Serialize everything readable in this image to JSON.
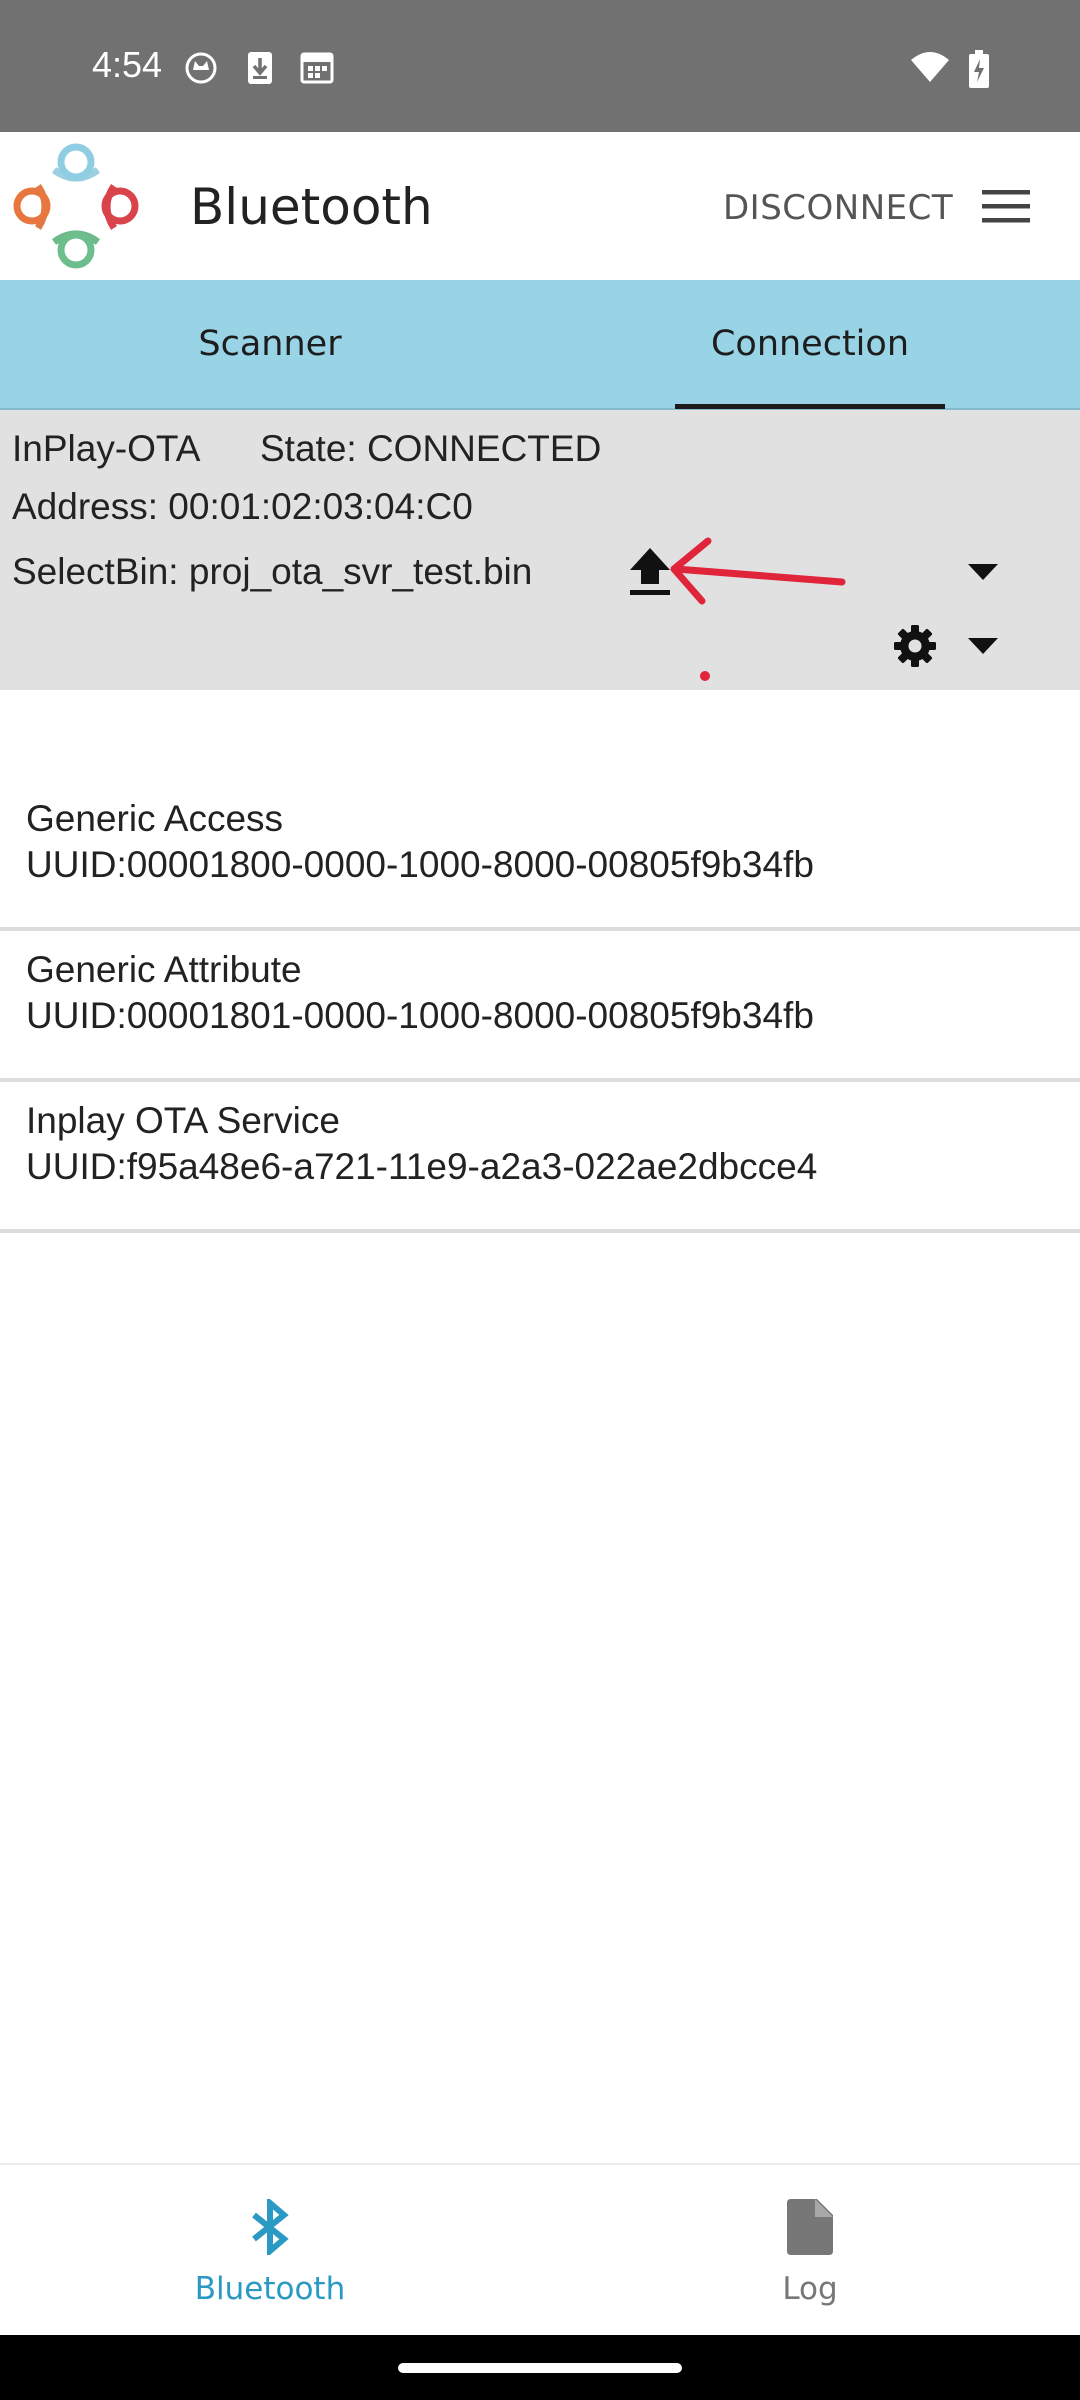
{
  "status_bar": {
    "time": "4:54",
    "icons": [
      "cat-notification-icon",
      "download-icon",
      "calendar-icon",
      "wifi-icon",
      "battery-charging-icon"
    ]
  },
  "app_bar": {
    "title": "Bluetooth",
    "disconnect_label": "DISCONNECT",
    "menu_icon": "hamburger-menu-icon"
  },
  "tabs": [
    {
      "label": "Scanner",
      "selected": false
    },
    {
      "label": "Connection",
      "selected": true
    }
  ],
  "device": {
    "name": "InPlay-OTA",
    "state": "State: CONNECTED",
    "address": "Address: 00:01:02:03:04:C0",
    "select_bin": "SelectBin: proj_ota_svr_test.bin"
  },
  "services": [
    {
      "name": "Generic Access",
      "uuid": "UUID:00001800-0000-1000-8000-00805f9b34fb"
    },
    {
      "name": "Generic Attribute",
      "uuid": "UUID:00001801-0000-1000-8000-00805f9b34fb"
    },
    {
      "name": "Inplay OTA Service",
      "uuid": "UUID:f95a48e6-a721-11e9-a2a3-022ae2dbcce4"
    }
  ],
  "bottom_nav": [
    {
      "label": "Bluetooth",
      "icon": "bluetooth-icon",
      "selected": true
    },
    {
      "label": "Log",
      "icon": "file-icon",
      "selected": false
    }
  ],
  "colors": {
    "status_bar_bg": "#717171",
    "tab_bar_bg": "#98d3e6",
    "info_panel_bg": "#e1e1e1",
    "accent": "#2a9ac4",
    "annotation_red": "#e0243a",
    "nav_inactive": "#777777"
  }
}
